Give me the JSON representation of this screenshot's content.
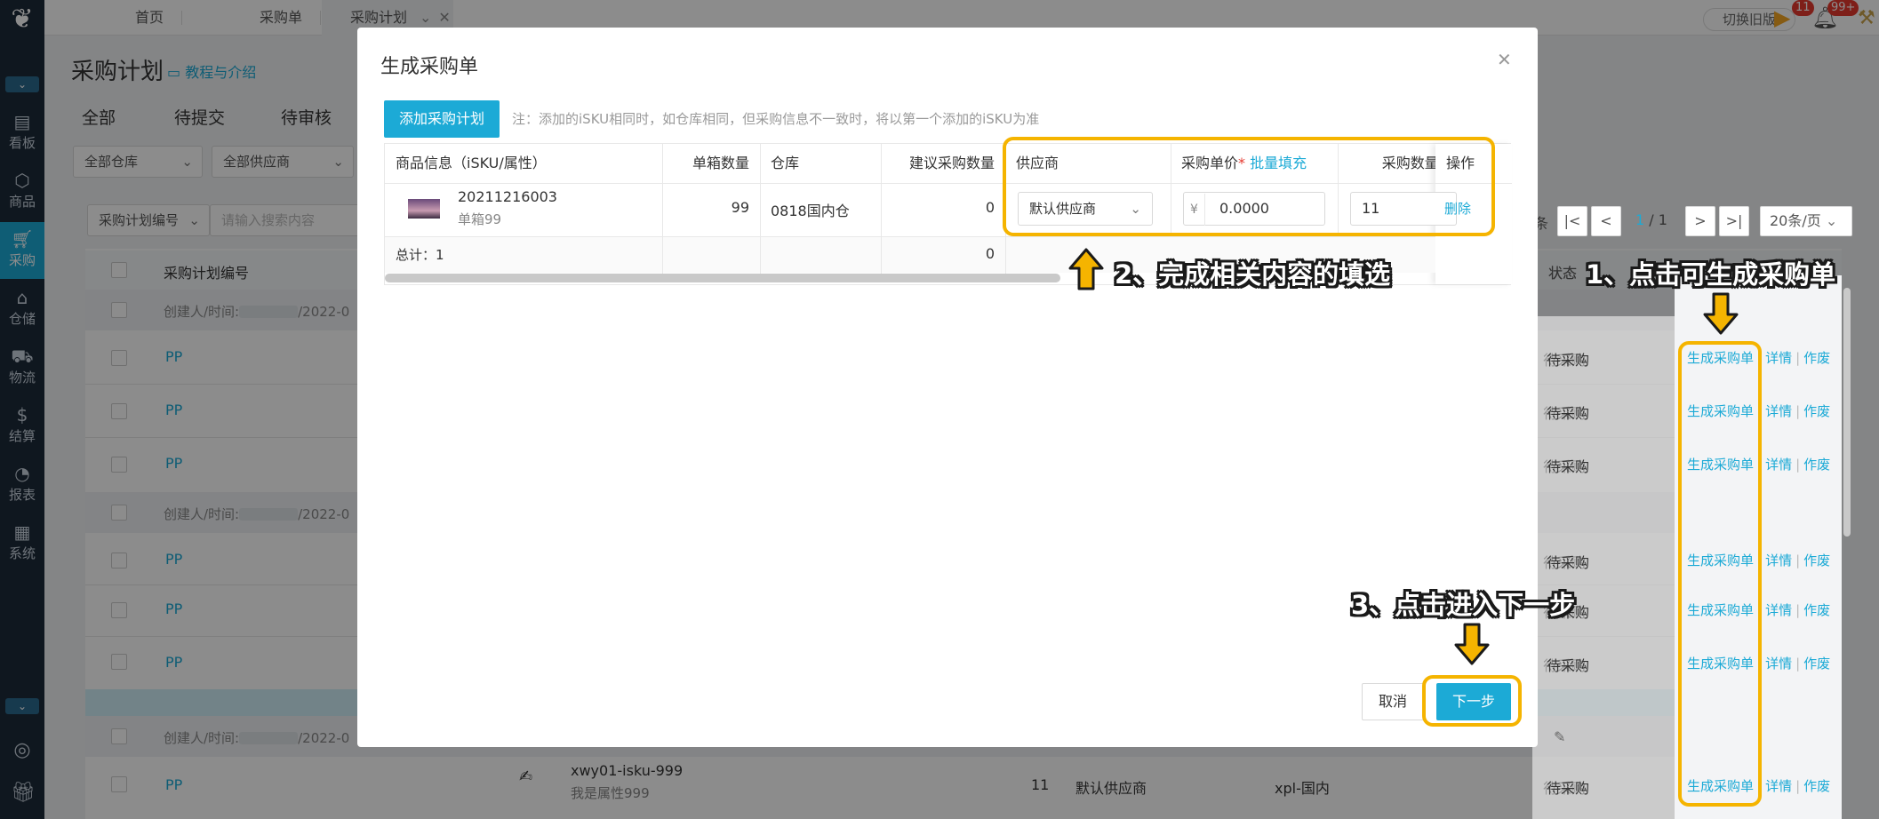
{
  "sidebar": {
    "items": [
      {
        "label": "看板",
        "icon": "chart-icon"
      },
      {
        "label": "商品",
        "icon": "box-icon"
      },
      {
        "label": "采购",
        "icon": "cart-icon"
      },
      {
        "label": "仓储",
        "icon": "warehouse-icon"
      },
      {
        "label": "物流",
        "icon": "truck-icon"
      },
      {
        "label": "结算",
        "icon": "money-icon"
      },
      {
        "label": "报表",
        "icon": "pie-icon"
      },
      {
        "label": "系统",
        "icon": "settings-icon"
      }
    ]
  },
  "topbar": {
    "tabs": [
      "首页",
      "采购单",
      "采购计划"
    ],
    "switch_old": "切换旧版",
    "badge_flag": "11",
    "badge_bell": "99+"
  },
  "page": {
    "title": "采购计划",
    "tutorial": "教程与介绍",
    "tabs": [
      "全部",
      "待提交",
      "待审核"
    ],
    "filter_warehouse": "全部仓库",
    "filter_supplier": "全部供应商",
    "search_field": "采购计划编号",
    "search_placeholder": "请输入搜索内容",
    "col_plan_no": "采购计划编号",
    "col_status": "状态",
    "creator_label": "创建人/时间:",
    "creator_date": "/2022-0",
    "pp_prefix": "PP",
    "status_pending": "待采购",
    "op_create": "生成采购单",
    "op_detail": "详情",
    "op_void": "作废",
    "pager_current": "1",
    "pager_total": "/ 1",
    "page_size": "20条/页",
    "row_bottom": {
      "sku": "xwy01-isku-999",
      "attr": "我是属性999",
      "qty": "11",
      "supplier": "默认供应商",
      "warehouse": "xpl-国内"
    }
  },
  "modal": {
    "title": "生成采购单",
    "add_button": "添加采购计划",
    "note": "注：添加的iSKU相同时，如仓库相同，但采购信息不一致时，将以第一个添加的iSKU为准",
    "headers": {
      "product": "商品信息（iSKU/属性）",
      "box_qty": "单箱数量",
      "warehouse": "仓库",
      "suggest": "建议采购数量",
      "supplier": "供应商",
      "price": "采购单价",
      "batch_fill": "批量填充",
      "qty": "采购数量",
      "batch_fill_cut": "批",
      "op": "操作"
    },
    "row": {
      "sku": "20211216003",
      "attr": "单箱99",
      "box_qty": "99",
      "warehouse": "0818国内仓",
      "suggest": "0",
      "supplier": "默认供应商",
      "currency": "¥",
      "price": "0.0000",
      "qty": "11",
      "delete": "删除"
    },
    "total_label": "总计：1",
    "total_suggest": "0",
    "cancel": "取消",
    "next": "下一步"
  },
  "annotations": {
    "step1": "1、点击可生成采购单",
    "step2": "2、完成相关内容的填选",
    "step3": "3、点击进入下一步",
    "color": "#f5b400"
  }
}
